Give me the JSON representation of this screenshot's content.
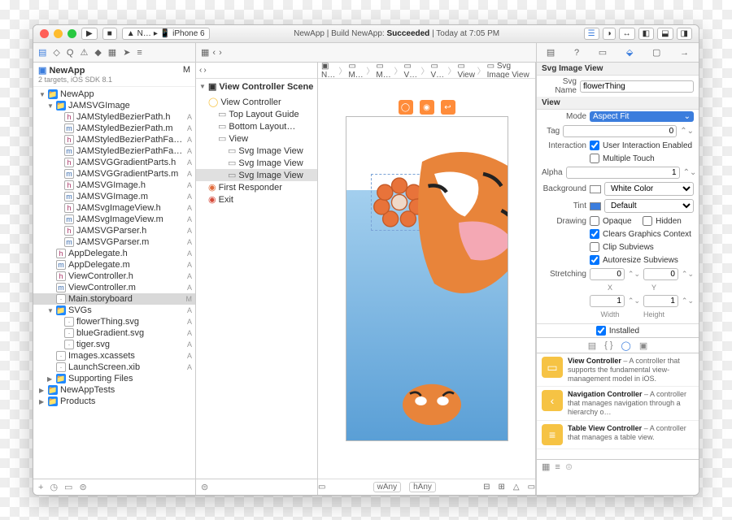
{
  "titlebar": {
    "scheme": "N…",
    "device": "iPhone 6",
    "app": "NewApp",
    "build_label": "Build NewApp:",
    "build_status": "Succeeded",
    "time": "Today at 7:05 PM"
  },
  "navigator": {
    "project": "NewApp",
    "subtitle": "2 targets, iOS SDK 8.1",
    "badge": "M",
    "tree": [
      {
        "d": 0,
        "t": "folder",
        "l": "NewApp",
        "open": true,
        "b": ""
      },
      {
        "d": 1,
        "t": "folder",
        "l": "JAMSVGImage",
        "open": true,
        "b": ""
      },
      {
        "d": 2,
        "t": "h",
        "l": "JAMStyledBezierPath.h",
        "b": "A"
      },
      {
        "d": 2,
        "t": "m",
        "l": "JAMStyledBezierPath.m",
        "b": "A"
      },
      {
        "d": 2,
        "t": "h",
        "l": "JAMStyledBezierPathFactory.h",
        "b": "A"
      },
      {
        "d": 2,
        "t": "m",
        "l": "JAMStyledBezierPathFactory.m",
        "b": "A"
      },
      {
        "d": 2,
        "t": "h",
        "l": "JAMSVGGradientParts.h",
        "b": "A"
      },
      {
        "d": 2,
        "t": "m",
        "l": "JAMSVGGradientParts.m",
        "b": "A"
      },
      {
        "d": 2,
        "t": "h",
        "l": "JAMSVGImage.h",
        "b": "A"
      },
      {
        "d": 2,
        "t": "m",
        "l": "JAMSVGImage.m",
        "b": "A"
      },
      {
        "d": 2,
        "t": "h",
        "l": "JAMSvgImageView.h",
        "b": "A"
      },
      {
        "d": 2,
        "t": "m",
        "l": "JAMSvgImageView.m",
        "b": "A"
      },
      {
        "d": 2,
        "t": "h",
        "l": "JAMSVGParser.h",
        "b": "A"
      },
      {
        "d": 2,
        "t": "m",
        "l": "JAMSVGParser.m",
        "b": "A"
      },
      {
        "d": 1,
        "t": "h",
        "l": "AppDelegate.h",
        "b": "A"
      },
      {
        "d": 1,
        "t": "m",
        "l": "AppDelegate.m",
        "b": "A"
      },
      {
        "d": 1,
        "t": "h",
        "l": "ViewController.h",
        "b": "A"
      },
      {
        "d": 1,
        "t": "m",
        "l": "ViewController.m",
        "b": "A"
      },
      {
        "d": 1,
        "t": "sb",
        "l": "Main.storyboard",
        "b": "M",
        "sel": true
      },
      {
        "d": 1,
        "t": "folder",
        "l": "SVGs",
        "open": true,
        "b": "A"
      },
      {
        "d": 2,
        "t": "sb",
        "l": "flowerThing.svg",
        "b": "A"
      },
      {
        "d": 2,
        "t": "sb",
        "l": "blueGradient.svg",
        "b": "A"
      },
      {
        "d": 2,
        "t": "sb",
        "l": "tiger.svg",
        "b": "A"
      },
      {
        "d": 1,
        "t": "sb",
        "l": "Images.xcassets",
        "b": "A"
      },
      {
        "d": 1,
        "t": "sb",
        "l": "LaunchScreen.xib",
        "b": "A"
      },
      {
        "d": 1,
        "t": "folder",
        "l": "Supporting Files",
        "open": false,
        "b": ""
      },
      {
        "d": 0,
        "t": "folder",
        "l": "NewAppTests",
        "open": false,
        "b": ""
      },
      {
        "d": 0,
        "t": "folder",
        "l": "Products",
        "open": false,
        "b": ""
      }
    ]
  },
  "outline": {
    "header": "View Controller Scene",
    "items": [
      {
        "d": 0,
        "l": "View Controller",
        "i": "◯",
        "c": "#f6c344"
      },
      {
        "d": 1,
        "l": "Top Layout Guide",
        "i": "▭"
      },
      {
        "d": 1,
        "l": "Bottom Layout…",
        "i": "▭"
      },
      {
        "d": 1,
        "l": "View",
        "i": "▭"
      },
      {
        "d": 2,
        "l": "Svg Image View",
        "i": "▭"
      },
      {
        "d": 2,
        "l": "Svg Image View",
        "i": "▭"
      },
      {
        "d": 2,
        "l": "Svg Image View",
        "i": "▭",
        "sel": true
      },
      {
        "d": 0,
        "l": "First Responder",
        "i": "◉",
        "c": "#e06a3a"
      },
      {
        "d": 0,
        "l": "Exit",
        "i": "◉",
        "c": "#d64a3a"
      }
    ]
  },
  "breadcrumb": [
    "N…",
    "M…",
    "M…",
    "V…",
    "V…",
    "View",
    "Svg Image View"
  ],
  "canvas": {
    "wAny": "wAny",
    "hAny": "hAny"
  },
  "inspector": {
    "title": "Svg Image View",
    "svgname_label": "Svg Name",
    "svgname": "flowerThing",
    "view_label": "View",
    "mode_label": "Mode",
    "mode": "Aspect Fit",
    "tag_label": "Tag",
    "tag": "0",
    "interaction_label": "Interaction",
    "user_interaction": "User Interaction Enabled",
    "multiple_touch": "Multiple Touch",
    "alpha_label": "Alpha",
    "alpha": "1",
    "background_label": "Background",
    "background": "White Color",
    "tint_label": "Tint",
    "tint": "Default",
    "drawing_label": "Drawing",
    "opaque": "Opaque",
    "hidden": "Hidden",
    "clears": "Clears Graphics Context",
    "clip": "Clip Subviews",
    "autoresize": "Autoresize Subviews",
    "stretching_label": "Stretching",
    "sx": "0",
    "sy": "0",
    "sw": "1",
    "sh": "1",
    "xlab": "X",
    "ylab": "Y",
    "wlab": "Width",
    "hlab": "Height",
    "installed": "Installed"
  },
  "library": [
    {
      "title": "View Controller",
      "desc": " – A controller that supports the fundamental view-management model in iOS.",
      "color": "#f6c344",
      "glyph": "▭"
    },
    {
      "title": "Navigation Controller",
      "desc": " – A controller that manages navigation through a hierarchy o…",
      "color": "#f6c344",
      "glyph": "‹"
    },
    {
      "title": "Table View Controller",
      "desc": " – A controller that manages a table view.",
      "color": "#f6c344",
      "glyph": "≡"
    }
  ]
}
